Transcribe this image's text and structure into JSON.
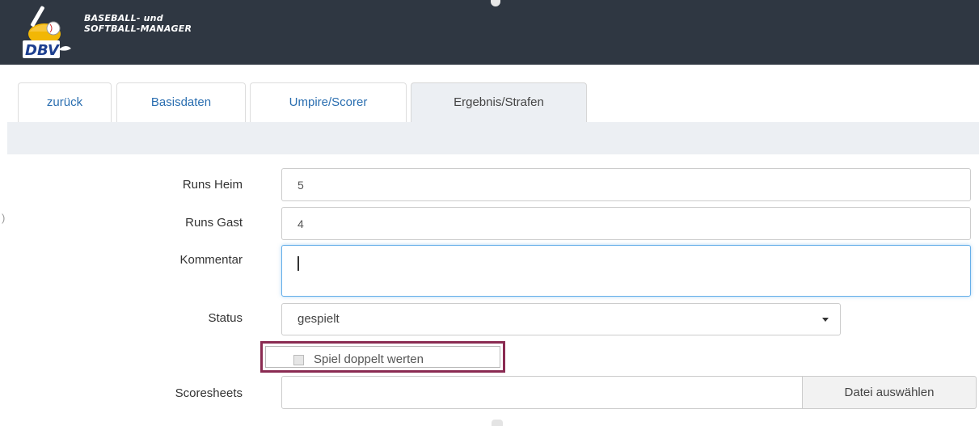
{
  "header": {
    "brand_line1": "BASEBALL- und",
    "brand_line2": "SOFTBALL-MANAGER",
    "logo_text": "DBV",
    "bg_color": "#2f3742"
  },
  "tabs": [
    {
      "label": "zurück"
    },
    {
      "label": "Basisdaten"
    },
    {
      "label": "Umpire/Scorer"
    },
    {
      "label": "Ergebnis/Strafen",
      "active": true
    }
  ],
  "form": {
    "runs_home": {
      "label": "Runs Heim",
      "value": "5"
    },
    "runs_guest": {
      "label": "Runs Gast",
      "value": "4"
    },
    "comment": {
      "label": "Kommentar",
      "value": ""
    },
    "status": {
      "label": "Status",
      "value": "gespielt"
    },
    "double_count": {
      "label": "Spiel doppelt werten",
      "checked": false
    },
    "scoresheets": {
      "label": "Scoresheets",
      "button_label": "Datei auswählen"
    }
  },
  "colors": {
    "link": "#2a6eb0",
    "focus": "#66afe9",
    "highlight_border": "#8a2b52"
  }
}
